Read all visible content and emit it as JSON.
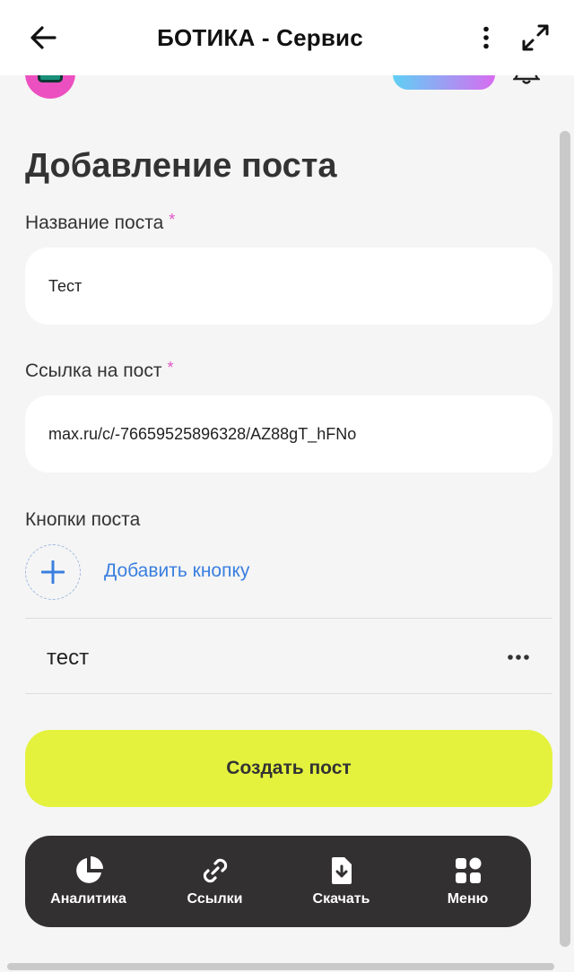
{
  "header": {
    "title": "БОТИКА - Сервис",
    "back_icon": "arrow-left-icon",
    "more_icon": "vertical-dots-icon",
    "expand_icon": "expand-arrows-icon"
  },
  "page": {
    "title": "Добавление поста"
  },
  "form": {
    "post_name": {
      "label": "Название поста",
      "required_mark": "*",
      "value": "Тест"
    },
    "post_link": {
      "label": "Ссылка на пост",
      "required_mark": "*",
      "value": "max.ru/c/-76659525896328/AZ88gT_hFNo"
    },
    "buttons": {
      "label": "Кнопки поста",
      "add_label": "Добавить кнопку",
      "items": [
        {
          "label": "тест"
        }
      ]
    },
    "submit_label": "Создать пост"
  },
  "nav": {
    "items": [
      {
        "label": "Аналитика",
        "icon": "pie-chart-icon"
      },
      {
        "label": "Ссылки",
        "icon": "link-icon"
      },
      {
        "label": "Скачать",
        "icon": "download-file-icon"
      },
      {
        "label": "Меню",
        "icon": "grid-menu-icon"
      }
    ]
  },
  "colors": {
    "accent_button": "#e4f23e",
    "link_blue": "#3a7fe0",
    "required_pink": "#e055c8",
    "nav_bg": "#333031"
  }
}
